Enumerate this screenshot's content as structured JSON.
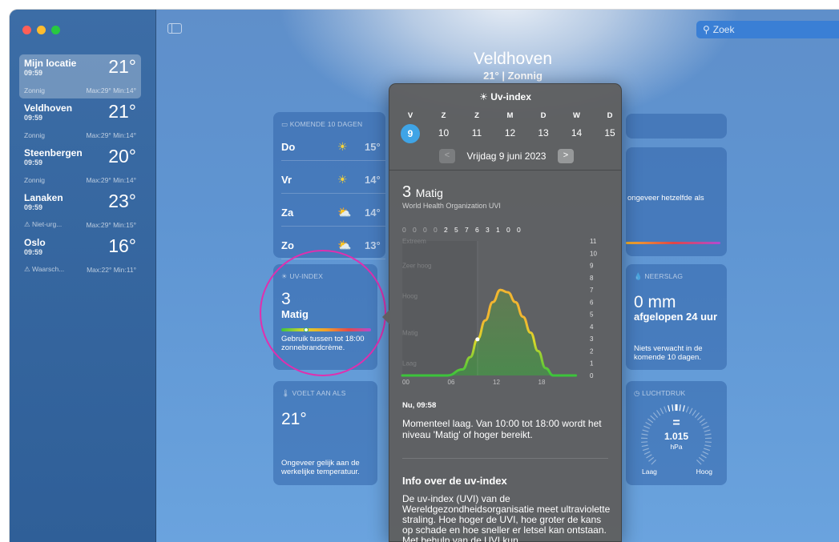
{
  "window": {
    "sidebar": {
      "locations": [
        {
          "name": "Mijn locatie",
          "time": "09:59",
          "temp": "21°",
          "cond": "Zonnig",
          "range": "Max:29° Min:14°"
        },
        {
          "name": "Veldhoven",
          "time": "09:59",
          "temp": "21°",
          "cond": "Zonnig",
          "range": "Max:29° Min:14°"
        },
        {
          "name": "Steenbergen",
          "time": "09:59",
          "temp": "20°",
          "cond": "Zonnig",
          "range": "Max:29° Min:14°"
        },
        {
          "name": "Lanaken",
          "time": "09:59",
          "temp": "23°",
          "cond": "⚠ Niet-urg...",
          "range": "Max:29° Min:15°"
        },
        {
          "name": "Oslo",
          "time": "09:59",
          "temp": "16°",
          "cond": "⚠ Waarsch...",
          "range": "Max:22° Min:11°"
        }
      ]
    },
    "search": {
      "placeholder": "Zoek"
    },
    "city": {
      "name": "Veldhoven",
      "summary": "21°  |  Zonnig"
    },
    "forecast": {
      "header": "KOMENDE 10 DAGEN",
      "rows": [
        {
          "day": "Do",
          "icon": "sun-icon",
          "glyph": "☀",
          "temp": "15°"
        },
        {
          "day": "Vr",
          "icon": "sun-icon",
          "glyph": "☀",
          "temp": "14°"
        },
        {
          "day": "Za",
          "icon": "partly-cloudy-icon",
          "glyph": "⛅",
          "temp": "14°"
        },
        {
          "day": "Zo",
          "icon": "partly-cloudy-icon",
          "glyph": "⛅",
          "temp": "13°"
        }
      ]
    },
    "uv_card": {
      "header": "☀ UV-INDEX",
      "value": "3",
      "level": "Matig",
      "note": "Gebruik tussen tot 18:00 zonnebrandcrème."
    },
    "feels": {
      "header": "🌡 VOELT AAN ALS",
      "value": "21°",
      "note": "Ongeveer gelijk aan de werkelijke temperatuur."
    },
    "right_card": {
      "text": "ongeveer hetzelfde als"
    },
    "rain": {
      "header": "💧 NEERSLAG",
      "value": "0 mm",
      "sub": "afgelopen 24 uur",
      "note": "Niets verwacht in de komende 10 dagen."
    },
    "pressure": {
      "header": "◷ LUCHTDRUK",
      "eq": "=",
      "value": "1.015",
      "unit": "hPa",
      "low": "Laag",
      "high": "Hoog"
    },
    "popover": {
      "title": "☀ Uv-index",
      "day_letters": [
        "V",
        "Z",
        "Z",
        "M",
        "D",
        "W",
        "D"
      ],
      "day_numbers": [
        "9",
        "10",
        "11",
        "12",
        "13",
        "14",
        "15"
      ],
      "date": "Vrijdag 9 juni 2023",
      "prev": "<",
      "next": ">",
      "value": "3",
      "level": "Matig",
      "source": "World Health Organization UVI",
      "now_label": "Nu, 09:58",
      "now_text": "Momenteel laag. Van 10:00 tot 18:00 wordt het niveau 'Matig' of hoger bereikt.",
      "info_heading": "Info over de uv-index",
      "info_text": "De uv-index (UVI) van de Wereldgezondheidsorganisatie meet ultraviolette straling. Hoe hoger de UVI, hoe groter de kans op schade en hoe sneller er letsel kan ontstaan. Met behulp van de UVI kun"
    }
  },
  "chart_data": {
    "type": "area",
    "title": "",
    "hourly_labels": [
      "0",
      "0",
      "0",
      "0",
      "2",
      "5",
      "7",
      "6",
      "3",
      "1",
      "0",
      "0"
    ],
    "x": [
      0,
      3,
      6,
      8,
      9,
      10,
      11,
      12,
      13,
      14,
      15,
      16,
      17,
      18,
      19,
      20,
      21,
      22,
      23
    ],
    "values": [
      0,
      0,
      0,
      0.5,
      1.5,
      3,
      4.5,
      6,
      7,
      6.8,
      6,
      4.8,
      3.5,
      2,
      0.6,
      0,
      0,
      0,
      0
    ],
    "x_ticks": [
      "00",
      "06",
      "12",
      "18"
    ],
    "y_ticks": [
      "0",
      "1",
      "2",
      "3",
      "4",
      "5",
      "6",
      "7",
      "8",
      "9",
      "10",
      "11"
    ],
    "ylim": [
      0,
      11
    ],
    "category_labels": [
      "Laag",
      "Matig",
      "Hoog",
      "Zeer hoog",
      "Extreem"
    ],
    "now_hour": 9.97
  }
}
